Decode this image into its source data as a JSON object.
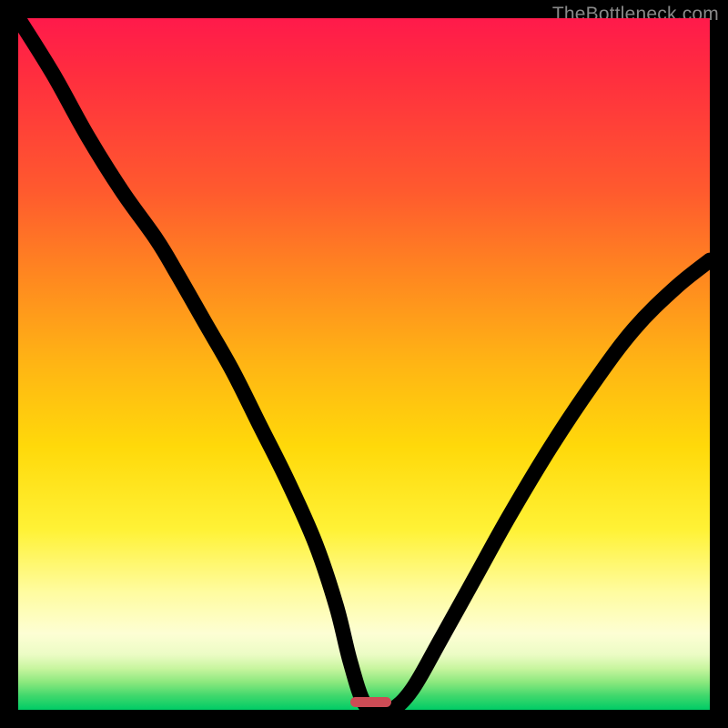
{
  "watermark": "TheBottleneck.com",
  "marker": {
    "x": 51,
    "width_pct": 6
  },
  "chart_data": {
    "type": "line",
    "title": "",
    "xlabel": "",
    "ylabel": "",
    "xlim": [
      0,
      100
    ],
    "ylim": [
      0,
      100
    ],
    "grid": false,
    "legend": false,
    "background_gradient": {
      "orientation": "vertical",
      "stops": [
        {
          "pct": 0,
          "color": "#ff1a4b"
        },
        {
          "pct": 25,
          "color": "#ff5a2e"
        },
        {
          "pct": 50,
          "color": "#ffb514"
        },
        {
          "pct": 74,
          "color": "#fff236"
        },
        {
          "pct": 89,
          "color": "#fdfed4"
        },
        {
          "pct": 96,
          "color": "#8ce87e"
        },
        {
          "pct": 100,
          "color": "#00cc66"
        }
      ]
    },
    "series": [
      {
        "name": "bottleneck-curve",
        "x": [
          0,
          5,
          10,
          15,
          20,
          23,
          27,
          31,
          35,
          39,
          43,
          46,
          48,
          50,
          52,
          54,
          57,
          61,
          66,
          71,
          77,
          83,
          89,
          95,
          100
        ],
        "y": [
          100,
          92,
          83,
          75,
          68,
          63,
          56,
          49,
          41,
          33,
          24,
          15,
          7,
          1,
          0,
          0,
          3,
          10,
          19,
          28,
          38,
          47,
          55,
          61,
          65
        ]
      }
    ],
    "marker": {
      "x": 51,
      "width_pct": 6,
      "color": "#cc4b55"
    }
  }
}
